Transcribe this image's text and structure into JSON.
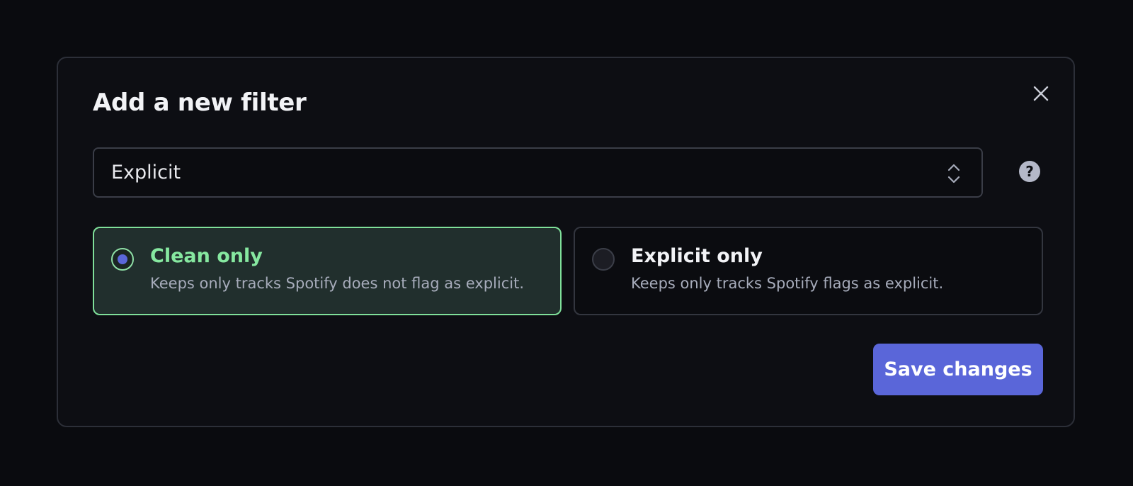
{
  "dialog": {
    "title": "Add a new filter",
    "close_icon": "close-icon",
    "help_icon": "help-icon",
    "help_glyph": "?"
  },
  "select": {
    "value": "Explicit",
    "icon": "chevron-up-down-icon"
  },
  "options": [
    {
      "title": "Clean only",
      "description": "Keeps only tracks Spotify does not flag as explicit.",
      "selected": true
    },
    {
      "title": "Explicit only",
      "description": "Keeps only tracks Spotify flags as explicit.",
      "selected": false
    }
  ],
  "actions": {
    "save_label": "Save changes"
  },
  "colors": {
    "accent": "#5a66d9",
    "selected_border": "#7fe09a",
    "selected_text": "#86e8a0",
    "background": "#0a0b0f"
  }
}
